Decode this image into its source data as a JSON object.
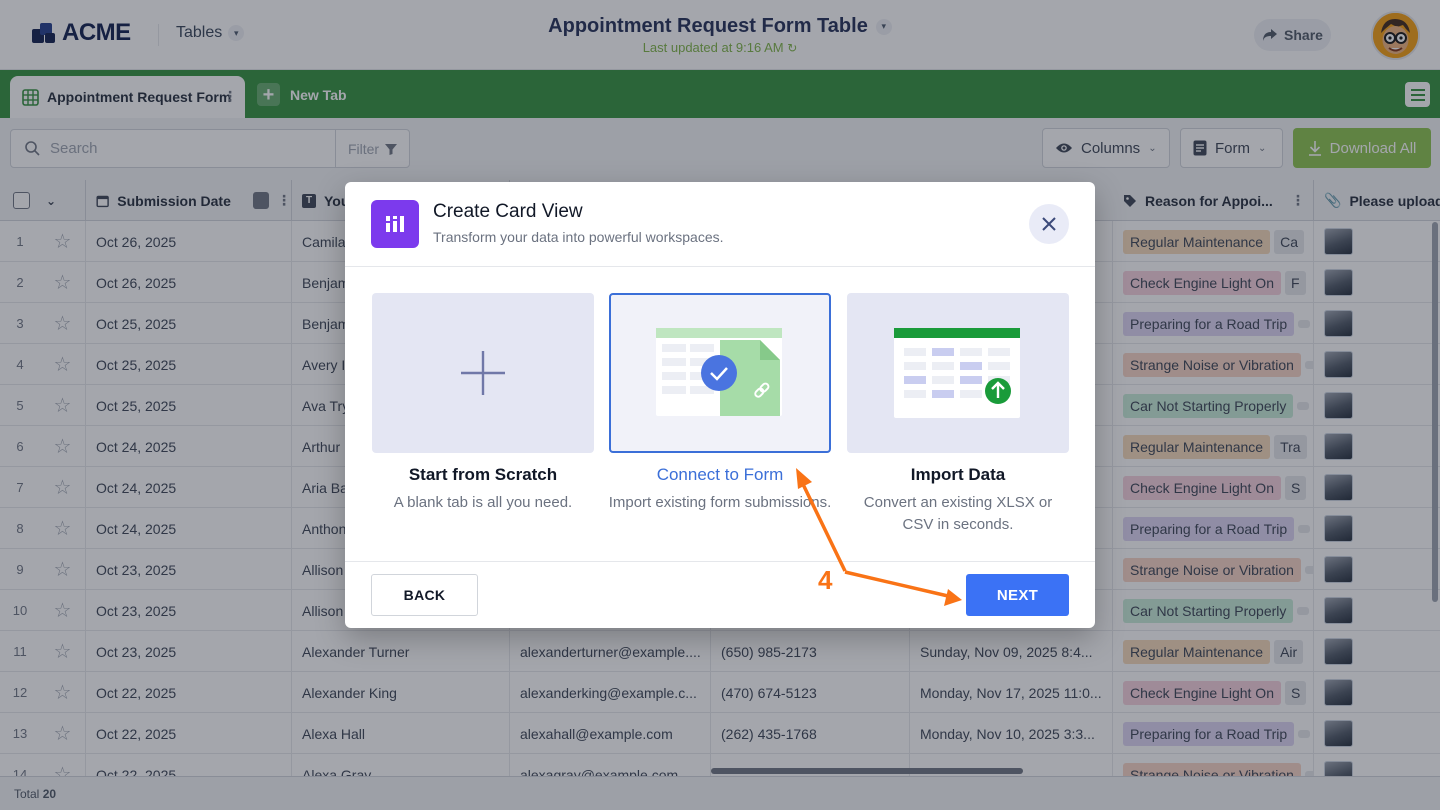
{
  "header": {
    "logo_text": "ACME",
    "tables_label": "Tables",
    "title": "Appointment Request Form Table",
    "subtitle": "Last updated at 9:16 AM",
    "share_label": "Share"
  },
  "tabs": {
    "active_label": "Appointment Request Form",
    "new_tab_label": "New Tab"
  },
  "toolbar": {
    "search_placeholder": "Search",
    "filter_label": "Filter",
    "columns_label": "Columns",
    "form_label": "Form",
    "download_label": "Download All"
  },
  "table": {
    "columns": [
      "Submission Date",
      "You",
      "Reason for Appoi...",
      "Please upload"
    ],
    "rows": [
      {
        "n": "1",
        "date": "Oct 26, 2025",
        "name": "Camila",
        "email": "",
        "phone": "",
        "appt": "",
        "reason": "Regular Maintenance",
        "reason2": "Ca"
      },
      {
        "n": "2",
        "date": "Oct 26, 2025",
        "name": "Benjam",
        "email": "",
        "phone": "",
        "appt": "",
        "reason": "Check Engine Light On",
        "reason2": "F"
      },
      {
        "n": "3",
        "date": "Oct 25, 2025",
        "name": "Benjam",
        "email": "",
        "phone": "",
        "appt": "",
        "reason": "Preparing for a Road Trip",
        "reason2": ""
      },
      {
        "n": "4",
        "date": "Oct 25, 2025",
        "name": "Avery I",
        "email": "",
        "phone": "",
        "appt": "",
        "reason": "Strange Noise or Vibration",
        "reason2": ""
      },
      {
        "n": "5",
        "date": "Oct 25, 2025",
        "name": "Ava Try",
        "email": "",
        "phone": "",
        "appt": "",
        "reason": "Car Not Starting Properly",
        "reason2": ""
      },
      {
        "n": "6",
        "date": "Oct 24, 2025",
        "name": "Arthur",
        "email": "",
        "phone": "",
        "appt": "",
        "reason": "Regular Maintenance",
        "reason2": "Tra"
      },
      {
        "n": "7",
        "date": "Oct 24, 2025",
        "name": "Aria Ba",
        "email": "",
        "phone": "",
        "appt": "",
        "reason": "Check Engine Light On",
        "reason2": "S"
      },
      {
        "n": "8",
        "date": "Oct 24, 2025",
        "name": "Anthon",
        "email": "",
        "phone": "",
        "appt": "",
        "reason": "Preparing for a Road Trip",
        "reason2": ""
      },
      {
        "n": "9",
        "date": "Oct 23, 2025",
        "name": "Allison",
        "email": "",
        "phone": "",
        "appt": "",
        "reason": "Strange Noise or Vibration",
        "reason2": ""
      },
      {
        "n": "10",
        "date": "Oct 23, 2025",
        "name": "Allison",
        "email": "",
        "phone": "",
        "appt": "",
        "reason": "Car Not Starting Properly",
        "reason2": ""
      },
      {
        "n": "11",
        "date": "Oct 23, 2025",
        "name": "Alexander Turner",
        "email": "alexanderturner@example....",
        "phone": "(650) 985-2173",
        "appt": "Sunday, Nov 09, 2025 8:4...",
        "reason": "Regular Maintenance",
        "reason2": "Air"
      },
      {
        "n": "12",
        "date": "Oct 22, 2025",
        "name": "Alexander King",
        "email": "alexanderking@example.c...",
        "phone": "(470) 674-5123",
        "appt": "Monday, Nov 17, 2025 11:0...",
        "reason": "Check Engine Light On",
        "reason2": "S"
      },
      {
        "n": "13",
        "date": "Oct 22, 2025",
        "name": "Alexa Hall",
        "email": "alexahall@example.com",
        "phone": "(262) 435-1768",
        "appt": "Monday, Nov 10, 2025 3:3...",
        "reason": "Preparing for a Road Trip",
        "reason2": ""
      },
      {
        "n": "14",
        "date": "Oct 22, 2025",
        "name": "Alexa Gray",
        "email": "alexagray@example.com",
        "phone": "",
        "appt": "",
        "reason": "Strange Noise or Vibration",
        "reason2": ""
      }
    ],
    "footer_label": "Total",
    "footer_count": "20"
  },
  "reason_colors": {
    "Regular Maintenance": "#f6d9b8",
    "Check Engine Light On": "#f7d0dc",
    "Preparing for a Road Trip": "#ddd5f3",
    "Strange Noise or Vibration": "#f8d4c4",
    "Car Not Starting Properly": "#c6ecd8"
  },
  "modal": {
    "title": "Create Card View",
    "subtitle": "Transform your data into powerful workspaces.",
    "options": [
      {
        "title": "Start from Scratch",
        "desc": "A blank tab is all you need."
      },
      {
        "title": "Connect to Form",
        "desc": "Import existing form submissions."
      },
      {
        "title": "Import Data",
        "desc": "Convert an existing XLSX or CSV in seconds."
      }
    ],
    "back_label": "BACK",
    "next_label": "NEXT"
  },
  "annotation": {
    "step_number": "4",
    "color": "#f97316"
  }
}
